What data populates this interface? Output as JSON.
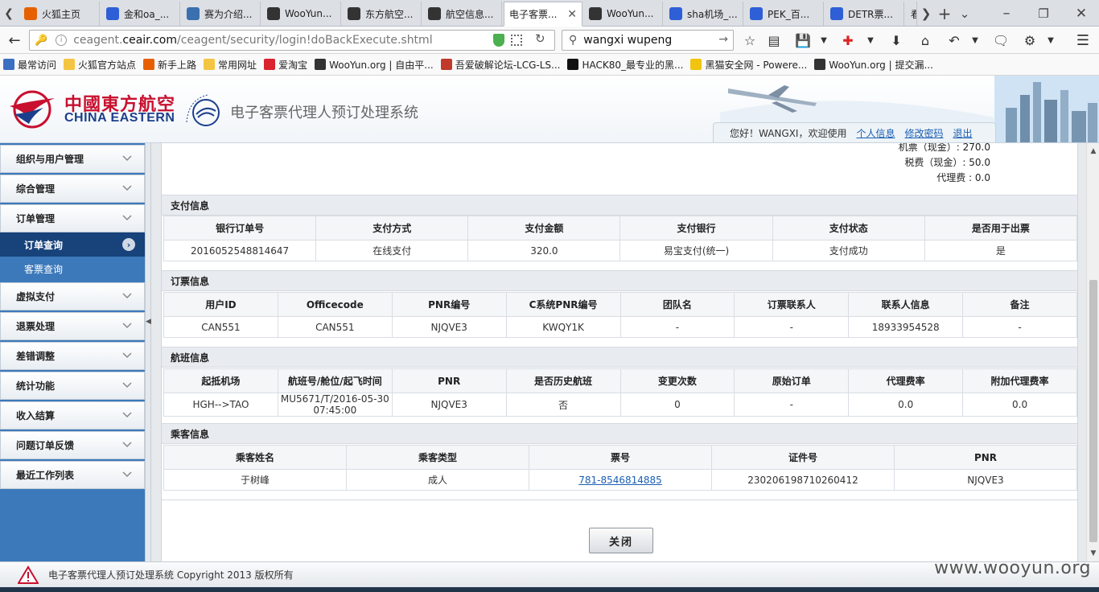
{
  "browser": {
    "tabs": [
      {
        "label": "火狐主页",
        "icon": "firefox-icon",
        "color": "#e66000"
      },
      {
        "label": "金和oa_...",
        "icon": "baidu-paw-icon",
        "color": "#2f5fd6"
      },
      {
        "label": "赛为介绍...",
        "icon": "globe-icon",
        "color": "#3a6fb0"
      },
      {
        "label": "WooYun...",
        "icon": "wooyun-icon",
        "color": "#333333"
      },
      {
        "label": "东方航空...",
        "icon": "wooyun-icon",
        "color": "#333333"
      },
      {
        "label": "航空信息...",
        "icon": "wooyun-icon",
        "color": "#333333"
      },
      {
        "label": "电子客票...",
        "icon": "none",
        "color": "#ffffff"
      },
      {
        "label": "WooYun...",
        "icon": "wooyun-icon",
        "color": "#333333"
      },
      {
        "label": "sha机场_...",
        "icon": "baidu-paw-icon",
        "color": "#2f5fd6"
      },
      {
        "label": "PEK_百...",
        "icon": "baidu-paw-icon",
        "color": "#2f5fd6"
      },
      {
        "label": "DETR票...",
        "icon": "baidu-paw-icon",
        "color": "#2f5fd6"
      },
      {
        "label": "看",
        "icon": "partial",
        "color": "#999999"
      }
    ],
    "url_prefix": "ceagent.",
    "url_host": "ceair.com",
    "url_path": "/ceagent/security/login!doBackExecute.shtml",
    "search_value": "wangxi wupeng",
    "bookmarks": [
      {
        "label": "最常访问",
        "color": "#3b6fc2"
      },
      {
        "label": "火狐官方站点",
        "color": "#f4c542"
      },
      {
        "label": "新手上路",
        "color": "#e66000"
      },
      {
        "label": "常用网址",
        "color": "#f4c542"
      },
      {
        "label": "爱淘宝",
        "color": "#d9232d"
      },
      {
        "label": "WooYun.org | 自由平...",
        "color": "#333333"
      },
      {
        "label": "吾爱破解论坛-LCG-LS...",
        "color": "#c0392b"
      },
      {
        "label": "HACK80_最专业的黑...",
        "color": "#111111"
      },
      {
        "label": "黑猫安全网 - Powere...",
        "color": "#f1c40f"
      },
      {
        "label": "WooYun.org | 提交漏...",
        "color": "#333333"
      }
    ]
  },
  "header": {
    "logo_cn": "中國東方航空",
    "logo_en": "CHINA EASTERN",
    "system_title": "电子客票代理人预订处理系统",
    "greeting": "您好！WANGXI，欢迎使用",
    "links": {
      "profile": "个人信息",
      "change_password": "修改密码",
      "logout": "退出"
    }
  },
  "sidebar": {
    "menus": [
      {
        "label": "组织与用户管理"
      },
      {
        "label": "综合管理"
      },
      {
        "label": "订单管理"
      },
      {
        "label": "虚拟支付"
      },
      {
        "label": "退票处理"
      },
      {
        "label": "差错调整"
      },
      {
        "label": "统计功能"
      },
      {
        "label": "收入结算"
      },
      {
        "label": "问题订单反馈"
      },
      {
        "label": "最近工作列表"
      }
    ],
    "submenus": [
      {
        "label": "订单查询",
        "active": true
      },
      {
        "label": "客票查询",
        "active": false
      }
    ]
  },
  "fares": {
    "ticket": "机票（现金）: 270.0",
    "tax": "税费（现金）: 50.0",
    "agent_fee": "代理费 : 0.0"
  },
  "payment": {
    "title": "支付信息",
    "columns": [
      "银行订单号",
      "支付方式",
      "支付金额",
      "支付银行",
      "支付状态",
      "是否用于出票"
    ],
    "row": [
      "2016052548814647",
      "在线支付",
      "320.0",
      "易宝支付(统一)",
      "支付成功",
      "是"
    ]
  },
  "booking": {
    "title": "订票信息",
    "columns": [
      "用户ID",
      "Officecode",
      "PNR编号",
      "C系统PNR编号",
      "团队名",
      "订票联系人",
      "联系人信息",
      "备注"
    ],
    "row": [
      "CAN551",
      "CAN551",
      "NJQVE3",
      "KWQY1K",
      "-",
      "-",
      "18933954528",
      "-"
    ]
  },
  "flight": {
    "title": "航班信息",
    "columns": [
      "起抵机场",
      "航班号/舱位/起飞时间",
      "PNR",
      "是否历史航班",
      "变更次数",
      "原始订单",
      "代理费率",
      "附加代理费率"
    ],
    "row": [
      "HGH-->TAO",
      "MU5671/T/2016-05-30 07:45:00",
      "NJQVE3",
      "否",
      "0",
      "-",
      "0.0",
      "0.0"
    ]
  },
  "passenger": {
    "title": "乘客信息",
    "columns": [
      "乘客姓名",
      "乘客类型",
      "票号",
      "证件号",
      "PNR"
    ],
    "row": [
      "于树峰",
      "成人",
      "781-8546814885",
      "230206198710260412",
      "NJQVE3"
    ]
  },
  "actions": {
    "close": "关闭"
  },
  "footer": {
    "copyright": "电子客票代理人预订处理系统 Copyright 2013 版权所有"
  },
  "watermark": "www.wooyun.org",
  "colors": {
    "sidebar_bg": "#3c79bb",
    "active_menu": "#17427a",
    "brand_red": "#c8102e",
    "brand_blue": "#1b3f8b",
    "link": "#1a5fb4"
  }
}
